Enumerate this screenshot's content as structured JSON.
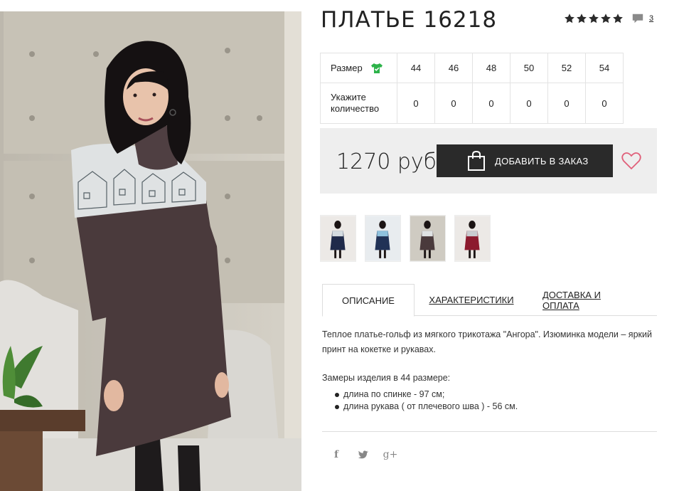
{
  "product": {
    "title": "ПЛАТЬЕ 16218",
    "rating_stars": 5,
    "review_count": "3"
  },
  "sizes": {
    "row_label": "Размер",
    "qty_label": "Укажите количество",
    "items": [
      {
        "size": "44",
        "qty": "0"
      },
      {
        "size": "46",
        "qty": "0"
      },
      {
        "size": "48",
        "qty": "0"
      },
      {
        "size": "50",
        "qty": "0"
      },
      {
        "size": "52",
        "qty": "0"
      },
      {
        "size": "54",
        "qty": "0"
      }
    ]
  },
  "purchase": {
    "price": "1270 руб",
    "add_button_label": "ДОБАВИТЬ В ЗАКАЗ"
  },
  "tabs": {
    "description": "ОПИСАНИЕ",
    "characteristics": "ХАРАКТЕРИСТИКИ",
    "delivery": "ДОСТАВКА И ОПЛАТА"
  },
  "description": {
    "text": "Теплое платье-гольф из мягкого трикотажа \"Ангора\". Изюминка модели – яркий принт на кокетке и рукавах.",
    "measures_title": "Замеры изделия в 44 размере:",
    "measures": [
      "длина по спинке - 97 см;",
      "длина рукава ( от плечевого шва ) - 56 см."
    ]
  },
  "social": {
    "facebook": "f",
    "twitter": "t",
    "googleplus": "g+"
  },
  "icons": {
    "star": "star-icon",
    "comment": "comment-icon",
    "size_guide": "tshirt-icon",
    "bag": "shopping-bag-icon",
    "favorite": "heart-icon"
  },
  "colors": {
    "accent_green": "#2db34a",
    "button_dark": "#2a2a2a",
    "heart_pink": "#e0607a",
    "price_bar_bg": "#eeeeee",
    "dress_brown": "#4a3a3c"
  }
}
